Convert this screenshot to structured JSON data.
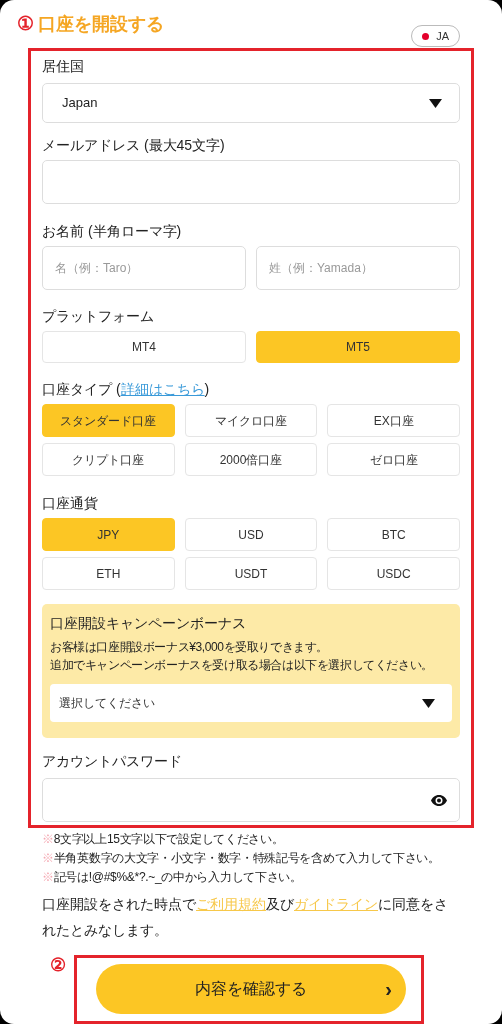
{
  "header": {
    "step": "①",
    "title": "口座を開設する",
    "language": "JA"
  },
  "country": {
    "label": "居住国",
    "value": "Japan"
  },
  "email": {
    "label": "メールアドレス (最大45文字)"
  },
  "name": {
    "label": "お名前 (半角ローマ字)",
    "fields": [
      {
        "placeholder": "名（例：Taro）"
      },
      {
        "placeholder": "姓（例：Yamada）"
      }
    ]
  },
  "platform": {
    "label": "プラットフォーム",
    "options": [
      {
        "label": "MT4",
        "selected": false
      },
      {
        "label": "MT5",
        "selected": true
      }
    ]
  },
  "account_type": {
    "label": "口座タイプ (",
    "link": "詳細はこちら",
    "label_end": ")",
    "options": [
      {
        "label": "スタンダード口座",
        "selected": true
      },
      {
        "label": "マイクロ口座",
        "selected": false
      },
      {
        "label": "EX口座",
        "selected": false
      },
      {
        "label": "クリプト口座",
        "selected": false
      },
      {
        "label": "2000倍口座",
        "selected": false
      },
      {
        "label": "ゼロ口座",
        "selected": false
      }
    ]
  },
  "currency": {
    "label": "口座通貨",
    "options": [
      {
        "label": "JPY",
        "selected": true
      },
      {
        "label": "USD",
        "selected": false
      },
      {
        "label": "BTC",
        "selected": false
      },
      {
        "label": "ETH",
        "selected": false
      },
      {
        "label": "USDT",
        "selected": false
      },
      {
        "label": "USDC",
        "selected": false
      }
    ]
  },
  "bonus": {
    "title": "口座開設キャンペーンボーナス",
    "lines": [
      "お客様は口座開設ボーナス¥3,000を受取りできます。",
      "追加でキャンペーンボーナスを受け取る場合は以下を選択してください。"
    ],
    "select": "選択してください"
  },
  "password": {
    "label": "アカウントパスワード"
  },
  "notes": [
    {
      "mark": "※",
      "text": "8文字以上15文字以下で設定してください。"
    },
    {
      "mark": "※",
      "text": "半角英数字の大文字・小文字・数字・特殊記号を含めて入力して下さい。"
    },
    {
      "mark": "※",
      "text": "記号は!@#$%&*?.~_の中から入力して下さい。"
    }
  ],
  "agreement": [
    {
      "kind": "text",
      "text": "口座開設をされた時点で"
    },
    {
      "kind": "link",
      "text": "ご利用規約"
    },
    {
      "kind": "text",
      "text": "及び"
    },
    {
      "kind": "link",
      "text": "ガイドライン"
    },
    {
      "kind": "text",
      "text": "に同意をされたとみなします。"
    }
  ],
  "submit": {
    "step": "②",
    "label": "内容を確認する",
    "arrow": "›"
  }
}
